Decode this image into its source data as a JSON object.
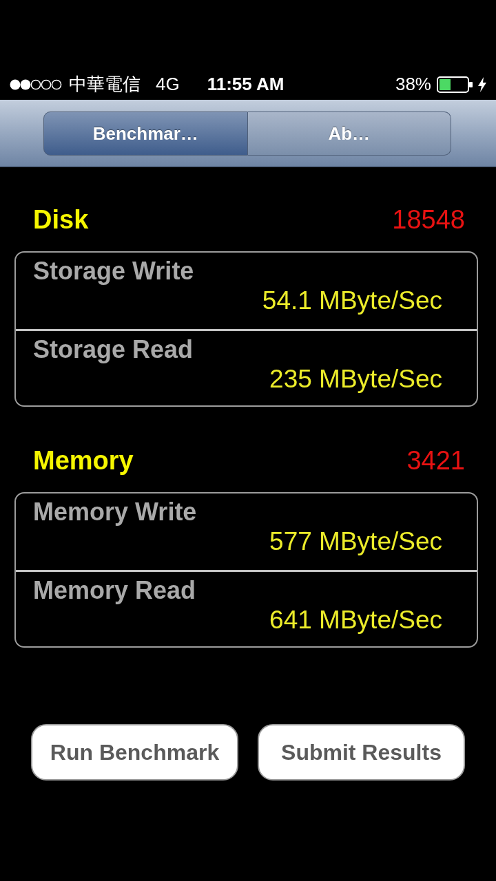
{
  "status_bar": {
    "carrier": "中華電信",
    "network": "4G",
    "time": "11:55 AM",
    "battery_percent": "38%",
    "charging": true
  },
  "segments": [
    {
      "label": "Benchmar…",
      "selected": true
    },
    {
      "label": "Ab…",
      "selected": false
    }
  ],
  "sections": [
    {
      "title": "Disk",
      "score": "18548",
      "rows": [
        {
          "label": "Storage Write",
          "value": "54.1 MByte/Sec"
        },
        {
          "label": "Storage Read",
          "value": "235 MByte/Sec"
        }
      ]
    },
    {
      "title": "Memory",
      "score": "3421",
      "rows": [
        {
          "label": "Memory Write",
          "value": "577 MByte/Sec"
        },
        {
          "label": "Memory Read",
          "value": "641 MByte/Sec"
        }
      ]
    }
  ],
  "buttons": [
    "Run Benchmark",
    "Submit Results"
  ]
}
